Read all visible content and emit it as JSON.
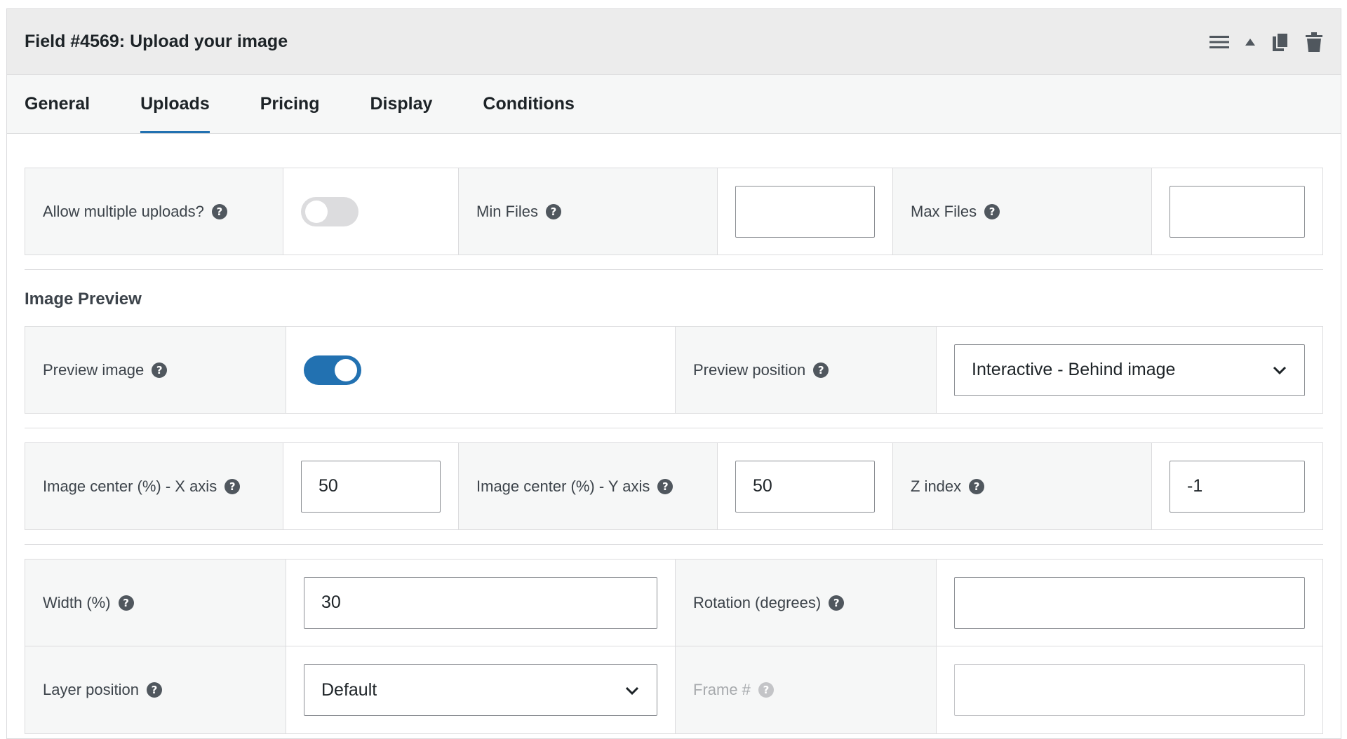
{
  "header": {
    "title": "Field #4569: Upload your image",
    "icons": [
      "menu-icon",
      "collapse-up-icon",
      "duplicate-icon",
      "trash-icon"
    ]
  },
  "tabs": [
    {
      "label": "General",
      "active": false
    },
    {
      "label": "Uploads",
      "active": true
    },
    {
      "label": "Pricing",
      "active": false
    },
    {
      "label": "Display",
      "active": false
    },
    {
      "label": "Conditions",
      "active": false
    }
  ],
  "uploads": {
    "allow_multiple_label": "Allow multiple uploads?",
    "allow_multiple_on": false,
    "min_files_label": "Min Files",
    "min_files_value": "",
    "max_files_label": "Max Files",
    "max_files_value": ""
  },
  "image_preview": {
    "section_title": "Image Preview",
    "preview_image_label": "Preview image",
    "preview_image_on": true,
    "preview_position_label": "Preview position",
    "preview_position_value": "Interactive - Behind image",
    "center_x_label": "Image center (%) - X axis",
    "center_x_value": "50",
    "center_y_label": "Image center (%) - Y axis",
    "center_y_value": "50",
    "z_index_label": "Z index",
    "z_index_value": "-1",
    "width_label": "Width (%)",
    "width_value": "30",
    "rotation_label": "Rotation (degrees)",
    "rotation_value": "",
    "layer_position_label": "Layer position",
    "layer_position_value": "Default",
    "frame_label": "Frame #",
    "frame_value": ""
  },
  "colors": {
    "accent": "#2271b1",
    "header_bg": "#ececec",
    "label_bg": "#f6f7f7",
    "border": "#dcdcde"
  },
  "help_glyph": "?"
}
